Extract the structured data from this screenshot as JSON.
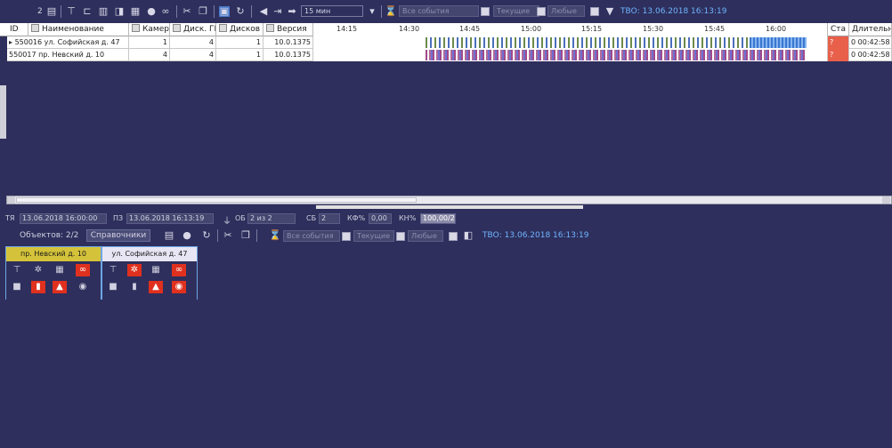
{
  "toolbar": {
    "page_number": "2",
    "interval": "15 мин",
    "filter_all": "Все события",
    "filter_current": "Текущие",
    "filter_any": "Любые",
    "tvo": "ТВО: 13.06.2018 16:13:19"
  },
  "table": {
    "columns": [
      "ID",
      "Наименование",
      "Камер",
      "Диск. ГБ",
      "Дисков",
      "Версия"
    ],
    "timeline_ticks": [
      "14:15",
      "14:30",
      "14:45",
      "15:00",
      "15:15",
      "15:30",
      "15:45",
      "16:00"
    ],
    "status_col": "Ста",
    "duration_col": "Длительно",
    "rows": [
      {
        "id": "550016",
        "name": "ул. Софийская д. 47",
        "cameras": "1",
        "disk": "4",
        "disks": "1",
        "version": "10.0.1375",
        "status": "?",
        "duration": "0 00:42:58"
      },
      {
        "id": "550017",
        "name": "пр. Невский д. 10",
        "cameras": "4",
        "disk": "4",
        "disks": "1",
        "version": "10.0.1375",
        "status": "?",
        "duration": "0 00:42:58"
      }
    ]
  },
  "status_bar": {
    "ty_label": "ТЯ",
    "ty_value": "13.06.2018 16:00:00",
    "pz_label": "ПЗ",
    "pz_value": "13.06.2018 16:13:19",
    "ob_label": "ОБ",
    "ob_value": "2 из 2",
    "sb_label": "СБ",
    "sb_value": "2",
    "kf_label": "КФ%",
    "kf_value": "0,00",
    "kn_label": "КН%",
    "kn_value": "100,00/2"
  },
  "toolbar2": {
    "objects": "Объектов: 2/2",
    "references": "Справочники",
    "filter_all": "Все события",
    "filter_current": "Текущие",
    "filter_any": "Любые",
    "tvo": "ТВО: 13.06.2018 16:13:19"
  },
  "cards": [
    {
      "title": "пр. Невский д. 10",
      "title_bg": "#d4c33a"
    },
    {
      "title": "ул. Софийская д. 47",
      "title_bg": "#e8e6f4"
    }
  ],
  "colors": {
    "background": "#2e2f5c",
    "accent": "#6fb4ff",
    "alarm": "#e0301e",
    "status_red": "#e8604a"
  }
}
